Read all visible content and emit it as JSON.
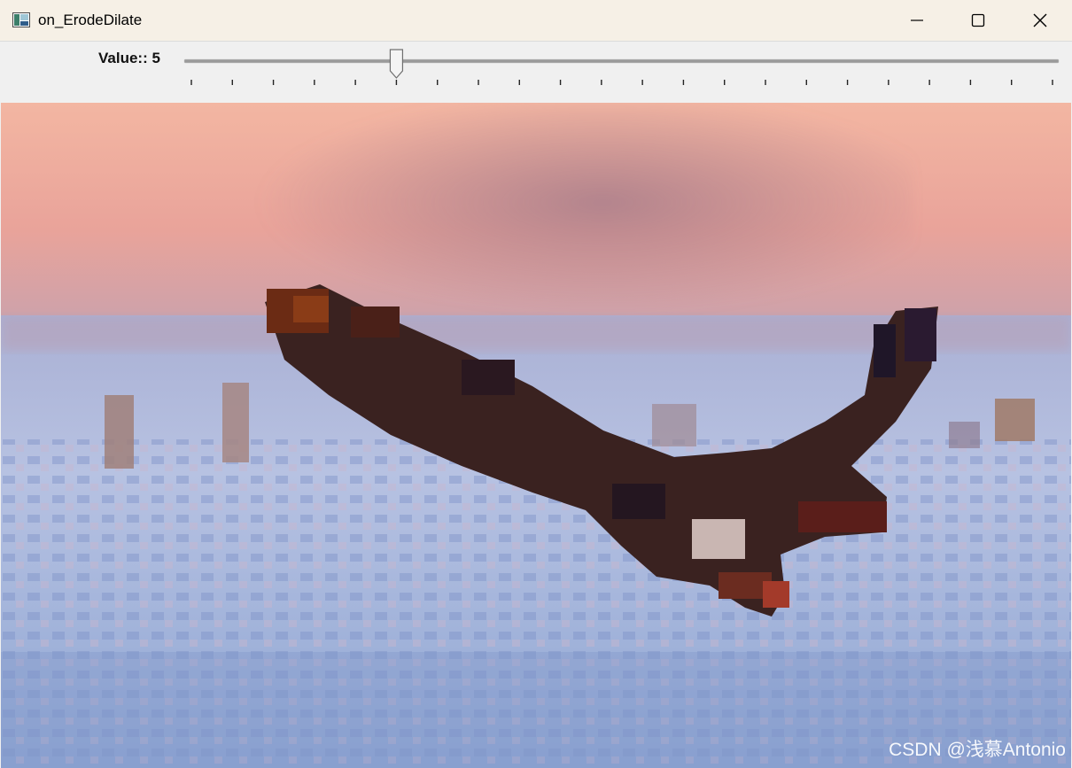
{
  "window": {
    "title": "on_ErodeDilate",
    "icon": "opencv-window-icon"
  },
  "titlebar_buttons": {
    "minimize_icon": "minimize-icon",
    "maximize_icon": "maximize-icon",
    "close_icon": "close-icon"
  },
  "trackbar": {
    "label": "Value:: 5",
    "value": 5,
    "min": 0,
    "max": 21
  },
  "image": {
    "description_icon": "eroded-eagle-image"
  },
  "watermark": {
    "text": "CSDN @浅慕Antonio"
  }
}
